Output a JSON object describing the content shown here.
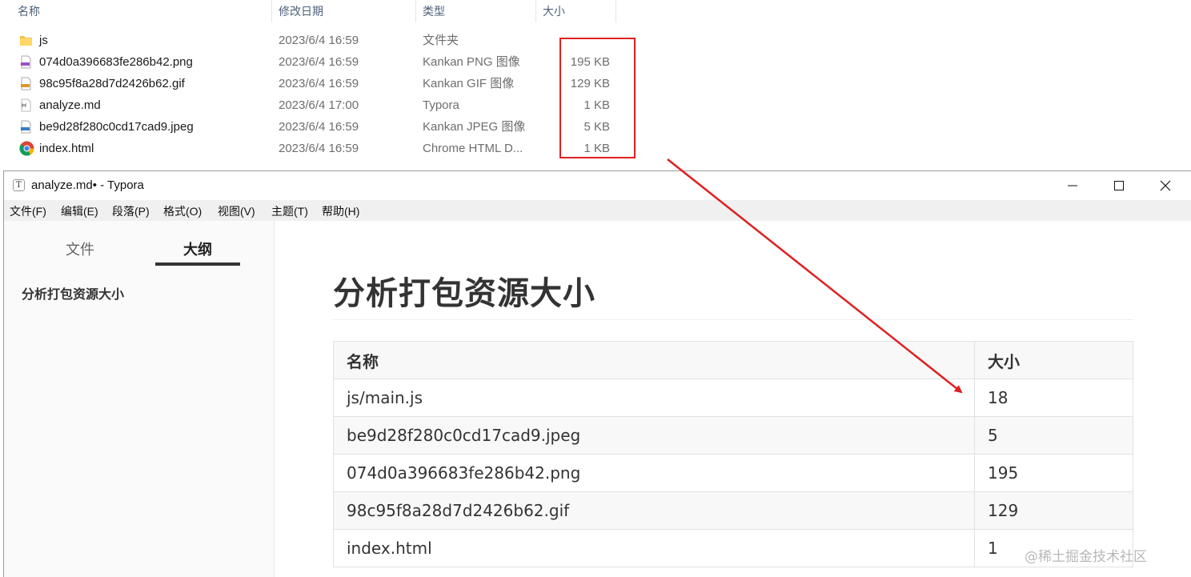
{
  "explorer": {
    "columns": {
      "name": "名称",
      "date": "修改日期",
      "type": "类型",
      "size": "大小"
    },
    "files": [
      {
        "name": "js",
        "date": "2023/6/4 16:59",
        "type": "文件夹",
        "size": "",
        "icon": "folder-icon"
      },
      {
        "name": "074d0a396683fe286b42.png",
        "date": "2023/6/4 16:59",
        "type": "Kankan PNG 图像",
        "size": "195 KB",
        "icon": "png-file-icon"
      },
      {
        "name": "98c95f8a28d7d2426b62.gif",
        "date": "2023/6/4 16:59",
        "type": "Kankan GIF 图像",
        "size": "129 KB",
        "icon": "gif-file-icon"
      },
      {
        "name": "analyze.md",
        "date": "2023/6/4 17:00",
        "type": "Typora",
        "size": "1 KB",
        "icon": "markdown-file-icon"
      },
      {
        "name": "be9d28f280c0cd17cad9.jpeg",
        "date": "2023/6/4 16:59",
        "type": "Kankan JPEG 图像",
        "size": "5 KB",
        "icon": "jpeg-file-icon"
      },
      {
        "name": "index.html",
        "date": "2023/6/4 16:59",
        "type": "Chrome HTML D...",
        "size": "1 KB",
        "icon": "chrome-icon"
      }
    ],
    "highlight_color": "#e02020"
  },
  "typora": {
    "title": "analyze.md• - Typora",
    "menu": [
      "文件(F)",
      "编辑(E)",
      "段落(P)",
      "格式(O)",
      "视图(V)",
      "主题(T)",
      "帮助(H)"
    ],
    "sidebar": {
      "tabs": [
        "文件",
        "大纲"
      ],
      "active_tab": "大纲",
      "outline": [
        "分析打包资源大小"
      ]
    },
    "document": {
      "heading": "分析打包资源大小",
      "table": {
        "headers": [
          "名称",
          "大小"
        ],
        "rows": [
          [
            "js/main.js",
            "18"
          ],
          [
            "be9d28f280c0cd17cad9.jpeg",
            "5"
          ],
          [
            "074d0a396683fe286b42.png",
            "195"
          ],
          [
            "98c95f8a28d7d2426b62.gif",
            "129"
          ],
          [
            "index.html",
            "1"
          ]
        ]
      }
    }
  },
  "watermark": "@稀土掘金技术社区"
}
